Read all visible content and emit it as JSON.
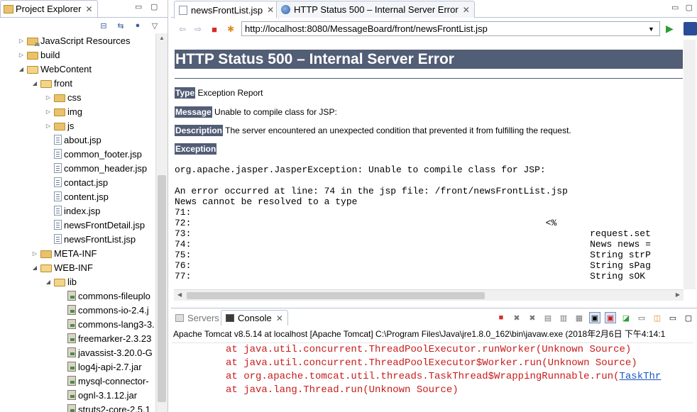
{
  "explorer": {
    "title": "Project Explorer",
    "tree": [
      {
        "label": "JavaScript Resources",
        "depth": 1,
        "kind": "jsres",
        "state": "collapsed"
      },
      {
        "label": "build",
        "depth": 1,
        "kind": "folder",
        "state": "collapsed"
      },
      {
        "label": "WebContent",
        "depth": 1,
        "kind": "folder",
        "state": "expanded"
      },
      {
        "label": "front",
        "depth": 2,
        "kind": "folder",
        "state": "expanded"
      },
      {
        "label": "css",
        "depth": 3,
        "kind": "folder",
        "state": "collapsed"
      },
      {
        "label": "img",
        "depth": 3,
        "kind": "folder",
        "state": "collapsed"
      },
      {
        "label": "js",
        "depth": 3,
        "kind": "folder",
        "state": "collapsed"
      },
      {
        "label": "about.jsp",
        "depth": 3,
        "kind": "jsp",
        "state": "leaf"
      },
      {
        "label": "common_footer.jsp",
        "depth": 3,
        "kind": "jsp",
        "state": "leaf"
      },
      {
        "label": "common_header.jsp",
        "depth": 3,
        "kind": "jsp",
        "state": "leaf"
      },
      {
        "label": "contact.jsp",
        "depth": 3,
        "kind": "jsp",
        "state": "leaf"
      },
      {
        "label": "content.jsp",
        "depth": 3,
        "kind": "jsp",
        "state": "leaf"
      },
      {
        "label": "index.jsp",
        "depth": 3,
        "kind": "jsp",
        "state": "leaf"
      },
      {
        "label": "newsFrontDetail.jsp",
        "depth": 3,
        "kind": "jsp",
        "state": "leaf"
      },
      {
        "label": "newsFrontList.jsp",
        "depth": 3,
        "kind": "jsp",
        "state": "leaf"
      },
      {
        "label": "META-INF",
        "depth": 2,
        "kind": "folder",
        "state": "collapsed"
      },
      {
        "label": "WEB-INF",
        "depth": 2,
        "kind": "folder",
        "state": "expanded"
      },
      {
        "label": "lib",
        "depth": 3,
        "kind": "folder",
        "state": "expanded"
      },
      {
        "label": "commons-fileuplo",
        "depth": 4,
        "kind": "jar",
        "state": "leaf"
      },
      {
        "label": "commons-io-2.4.j",
        "depth": 4,
        "kind": "jar",
        "state": "leaf"
      },
      {
        "label": "commons-lang3-3.",
        "depth": 4,
        "kind": "jar",
        "state": "leaf"
      },
      {
        "label": "freemarker-2.3.23",
        "depth": 4,
        "kind": "jar",
        "state": "leaf"
      },
      {
        "label": "javassist-3.20.0-G",
        "depth": 4,
        "kind": "jar",
        "state": "leaf"
      },
      {
        "label": "log4j-api-2.7.jar",
        "depth": 4,
        "kind": "jar",
        "state": "leaf"
      },
      {
        "label": "mysql-connector-",
        "depth": 4,
        "kind": "jar",
        "state": "leaf"
      },
      {
        "label": "ognl-3.1.12.jar",
        "depth": 4,
        "kind": "jar",
        "state": "leaf"
      },
      {
        "label": "struts2-core-2.5.1",
        "depth": 4,
        "kind": "jar",
        "state": "leaf"
      }
    ]
  },
  "editor": {
    "tabs": [
      {
        "label": "newsFrontList.jsp",
        "active": true
      },
      {
        "label": "HTTP Status 500 – Internal Server Error",
        "active": false
      }
    ],
    "url": "http://localhost:8080/MessageBoard/front/newsFrontList.jsp"
  },
  "page": {
    "heading": "HTTP Status 500 – Internal Server Error",
    "type_label": "Type",
    "type_value": " Exception Report",
    "message_label": "Message",
    "message_value": " Unable to compile class for JSP:",
    "description_label": "Description",
    "description_value": " The server encountered an unexpected condition that prevented it from fulfilling the request.",
    "exception_label": "Exception",
    "code_lines": [
      "org.apache.jasper.JasperException: Unable to compile class for JSP:",
      "",
      "An error occurred at line: 74 in the jsp file: /front/newsFrontList.jsp",
      "News cannot be resolved to a type",
      "71:",
      "72:                                                                <%",
      "73:                                                                        request.set",
      "74:                                                                        News news =",
      "75:                                                                        String strP",
      "76:                                                                        String sPag",
      "77:                                                                        String sOK "
    ]
  },
  "console": {
    "servers_tab": "Servers",
    "console_tab": "Console",
    "header": "Apache Tomcat v8.5.14 at localhost [Apache Tomcat] C:\\Program Files\\Java\\jre1.8.0_162\\bin\\javaw.exe (2018年2月6日 下午4:14:1",
    "lines": [
      {
        "text": "at java.util.concurrent.ThreadPoolExecutor.runWorker(Unknown Source)",
        "link": ""
      },
      {
        "text": "at java.util.concurrent.ThreadPoolExecutor$Worker.run(Unknown Source)",
        "link": ""
      },
      {
        "text": "at org.apache.tomcat.util.threads.TaskThread$WrappingRunnable.run(",
        "link": "TaskThr"
      },
      {
        "text": "at java.lang.Thread.run(Unknown Source)",
        "link": ""
      }
    ]
  }
}
